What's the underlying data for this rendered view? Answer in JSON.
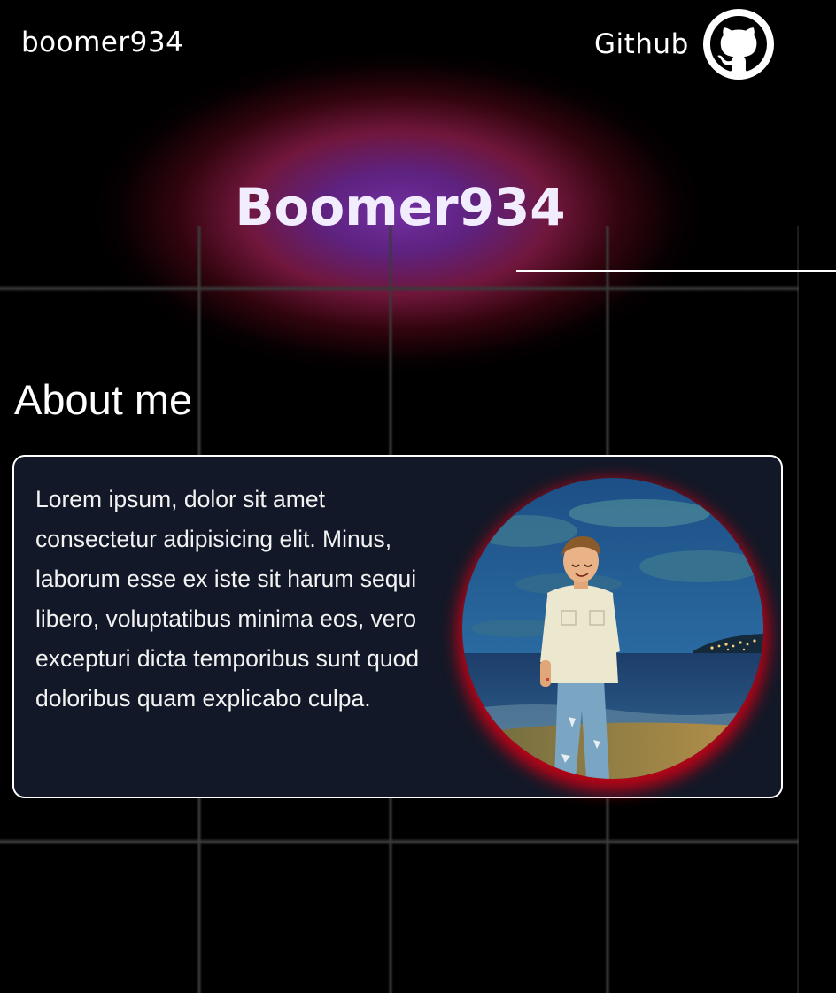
{
  "header": {
    "brand": "boomer934",
    "github_label": "Github",
    "github_icon": "github-icon"
  },
  "hero": {
    "title": "Boomer934"
  },
  "about": {
    "heading": "About me",
    "text": "Lorem ipsum, dolor sit amet consectetur adipisicing elit. Minus, laborum esse ex iste sit harum sequi libero, voluptatibus minima eos, vero excepturi dicta temporibus sunt quod doloribus quam explicabo culpa.",
    "avatar_icon": "avatar-illustration"
  },
  "colors": {
    "background": "#000000",
    "card_background": "#121827",
    "glow_purple": "#7832aa",
    "glow_red": "#961e50",
    "avatar_shadow": "#dc0014",
    "text": "#ffffff"
  }
}
